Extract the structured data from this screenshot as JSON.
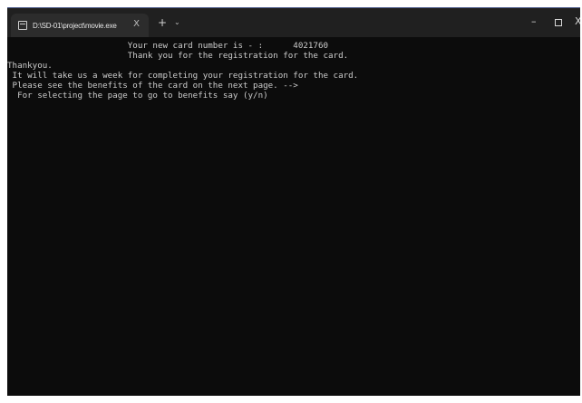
{
  "tab": {
    "title": "D:\\SD-01\\project\\movie.exe",
    "close_glyph": "X",
    "new_tab_glyph": "+",
    "dropdown_glyph": "⌄"
  },
  "window_controls": {
    "minimize_glyph": "–",
    "close_glyph": "X"
  },
  "console": {
    "lines": [
      "                        Your new card number is - :      4021760",
      "                        Thank you for the registration for the card.",
      "Thankyou.",
      " It will take us a week for completing your registration for the card.",
      " Please see the benefits of the card on the next page. -->",
      "  For selecting the page to go to benefits say (y/n)"
    ]
  },
  "colors": {
    "console_bg": "#0c0c0c",
    "console_text": "#cccccc",
    "tabbar_bg": "#202020",
    "tab_bg": "#2c2c2c"
  }
}
